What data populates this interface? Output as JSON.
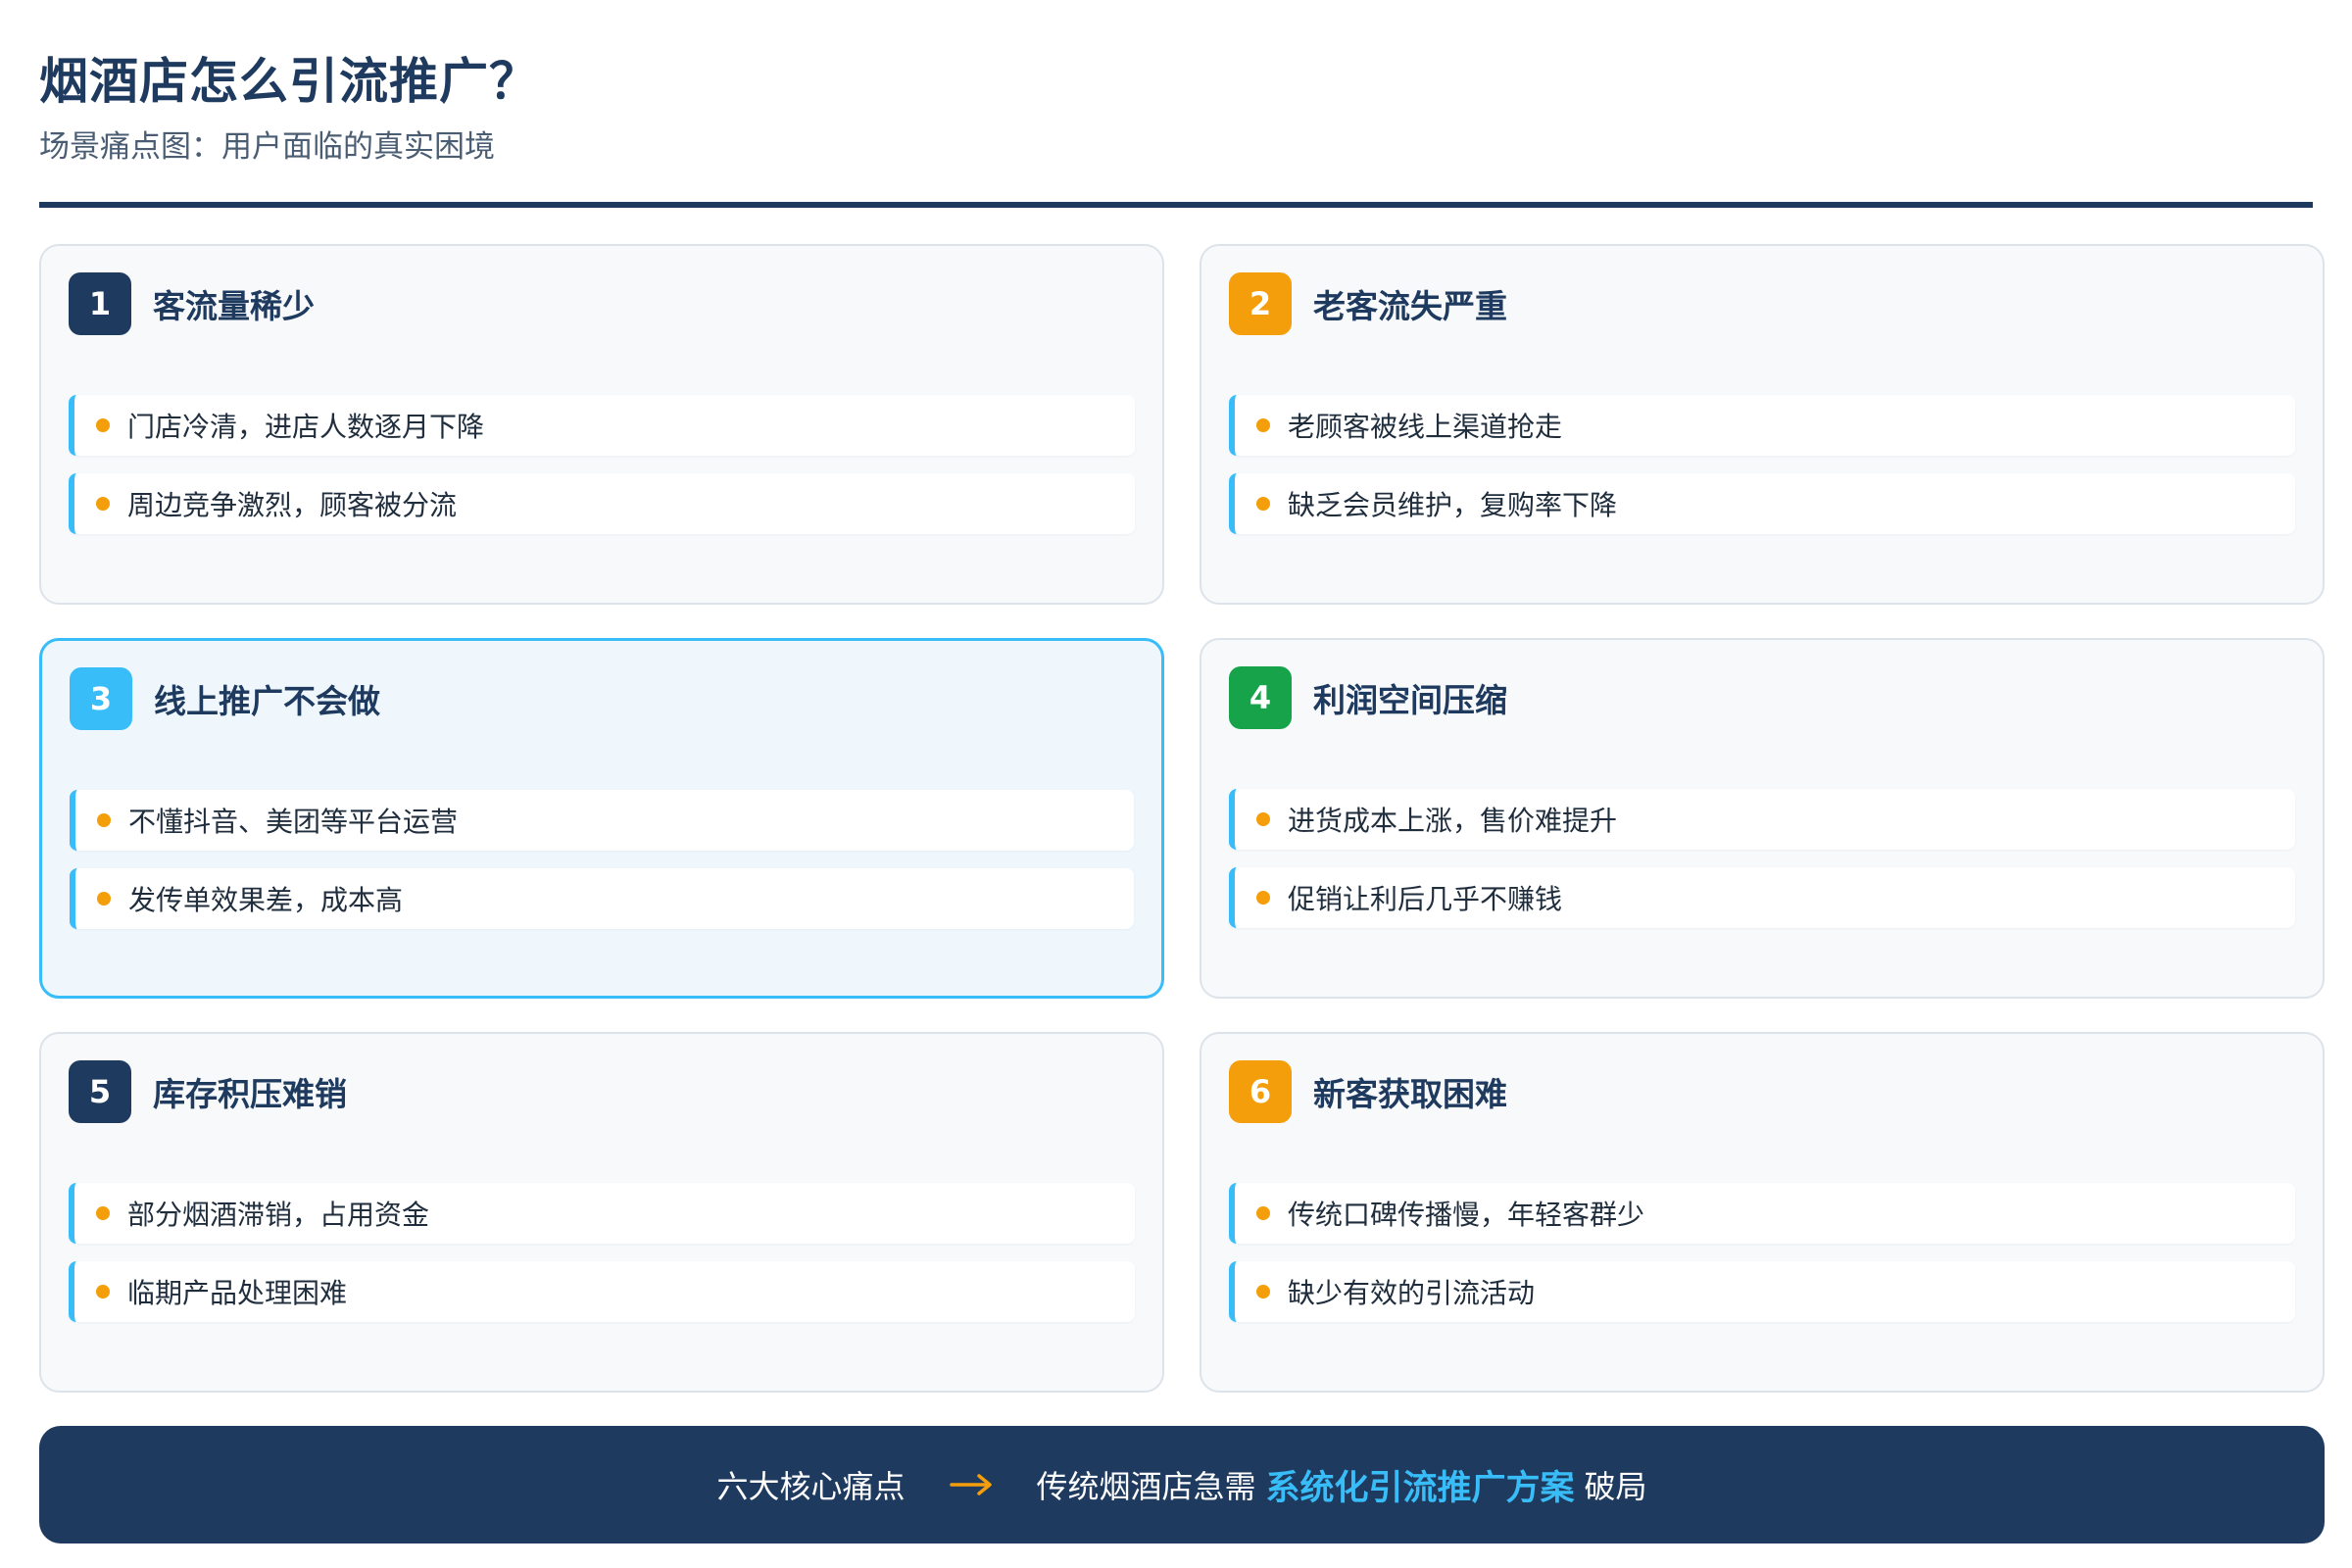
{
  "header": {
    "title": "烟酒店怎么引流推广？",
    "subtitle": "场景痛点图：用户面临的真实困境"
  },
  "colors": {
    "navy": "#1f3a5f",
    "orange": "#f59e0b",
    "sky": "#38bdf8",
    "green": "#16a34a"
  },
  "cards": [
    {
      "number": "1",
      "title": "客流量稀少",
      "badge_color": "#1f3a5f",
      "highlighted": false,
      "points": [
        "门店冷清，进店人数逐月下降",
        "周边竞争激烈，顾客被分流"
      ]
    },
    {
      "number": "2",
      "title": "老客流失严重",
      "badge_color": "#f59e0b",
      "highlighted": false,
      "points": [
        "老顾客被线上渠道抢走",
        "缺乏会员维护，复购率下降"
      ]
    },
    {
      "number": "3",
      "title": "线上推广不会做",
      "badge_color": "#38bdf8",
      "highlighted": true,
      "points": [
        "不懂抖音、美团等平台运营",
        "发传单效果差，成本高"
      ]
    },
    {
      "number": "4",
      "title": "利润空间压缩",
      "badge_color": "#16a34a",
      "highlighted": false,
      "points": [
        "进货成本上涨，售价难提升",
        "促销让利后几乎不赚钱"
      ]
    },
    {
      "number": "5",
      "title": "库存积压难销",
      "badge_color": "#1f3a5f",
      "highlighted": false,
      "points": [
        "部分烟酒滞销，占用资金",
        "临期产品处理困难"
      ]
    },
    {
      "number": "6",
      "title": "新客获取困难",
      "badge_color": "#f59e0b",
      "highlighted": false,
      "points": [
        "传统口碑传播慢，年轻客群少",
        "缺少有效的引流活动"
      ]
    }
  ],
  "banner": {
    "left_text": "六大核心痛点",
    "arrow_icon": "arrow-right-icon",
    "mid_text": "传统烟酒店急需",
    "highlight_text": "系统化引流推广方案",
    "end_text": "破局"
  }
}
